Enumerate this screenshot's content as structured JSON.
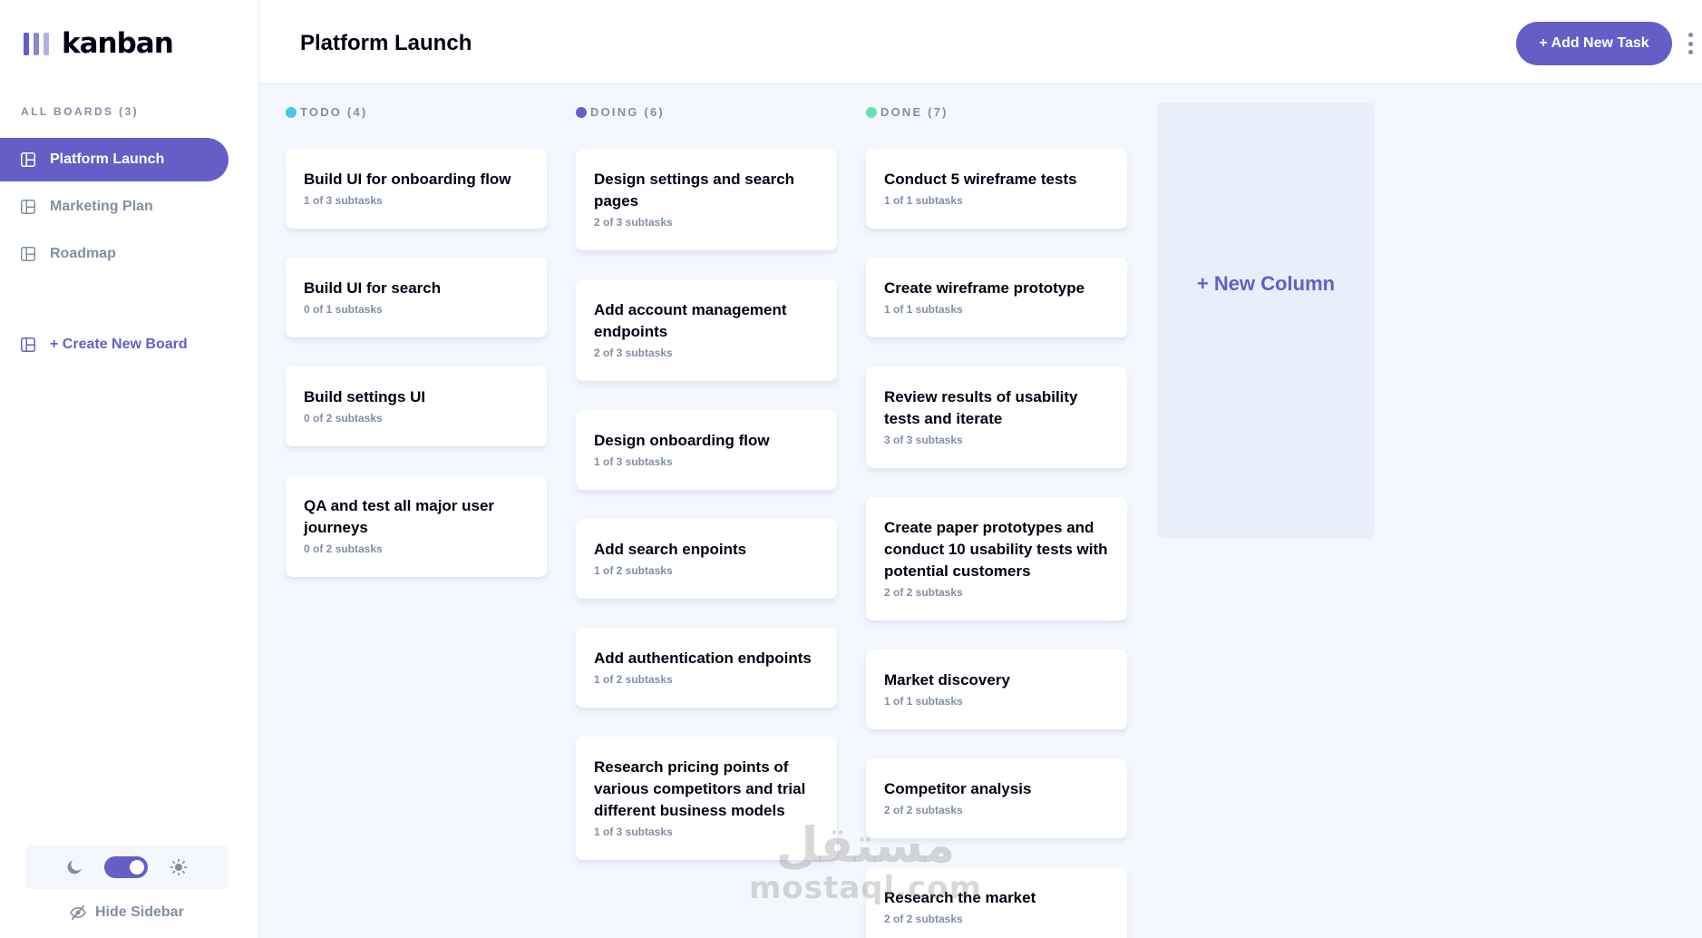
{
  "app": {
    "name": "kanban"
  },
  "sidebar": {
    "all_boards_label": "ALL BOARDS (3)",
    "boards": [
      {
        "label": "Platform Launch",
        "active": true
      },
      {
        "label": "Marketing Plan",
        "active": false
      },
      {
        "label": "Roadmap",
        "active": false
      }
    ],
    "create_board_label": "+ Create New Board",
    "hide_sidebar_label": "Hide Sidebar",
    "theme": {
      "mode": "dark-toggle-on",
      "moon_icon": "moon-icon",
      "sun_icon": "sun-icon"
    }
  },
  "header": {
    "board_title": "Platform Launch",
    "add_task_label": "+ Add New Task"
  },
  "columns": [
    {
      "title": "TODO (4)",
      "color": "#49c4e5",
      "cards": [
        {
          "title": "Build UI for onboarding flow",
          "subtasks": "1 of 3 subtasks"
        },
        {
          "title": "Build UI for search",
          "subtasks": "0 of 1 subtasks"
        },
        {
          "title": "Build settings UI",
          "subtasks": "0 of 2 subtasks"
        },
        {
          "title": "QA and test all major user journeys",
          "subtasks": "0 of 2 subtasks"
        }
      ]
    },
    {
      "title": "DOING (6)",
      "color": "#635fc7",
      "cards": [
        {
          "title": "Design settings and search pages",
          "subtasks": "2 of 3 subtasks"
        },
        {
          "title": "Add account management endpoints",
          "subtasks": "2 of 3 subtasks"
        },
        {
          "title": "Design onboarding flow",
          "subtasks": "1 of 3 subtasks"
        },
        {
          "title": "Add search enpoints",
          "subtasks": "1 of 2 subtasks"
        },
        {
          "title": "Add authentication endpoints",
          "subtasks": "1 of 2 subtasks"
        },
        {
          "title": "Research pricing points of various competitors and trial different business models",
          "subtasks": "1 of 3 subtasks"
        }
      ]
    },
    {
      "title": "DONE (7)",
      "color": "#67e2ae",
      "cards": [
        {
          "title": "Conduct 5 wireframe tests",
          "subtasks": "1 of 1 subtasks"
        },
        {
          "title": "Create wireframe prototype",
          "subtasks": "1 of 1 subtasks"
        },
        {
          "title": "Review results of usability tests and iterate",
          "subtasks": "3 of 3 subtasks"
        },
        {
          "title": "Create paper prototypes and conduct 10 usability tests with potential customers",
          "subtasks": "2 of 2 subtasks"
        },
        {
          "title": "Market discovery",
          "subtasks": "1 of 1 subtasks"
        },
        {
          "title": "Competitor analysis",
          "subtasks": "2 of 2 subtasks"
        },
        {
          "title": "Research the market",
          "subtasks": "2 of 2 subtasks"
        }
      ]
    }
  ],
  "new_column_label": "+ New Column",
  "watermark": {
    "logo": "مستقل",
    "text": "mostaql.com"
  }
}
